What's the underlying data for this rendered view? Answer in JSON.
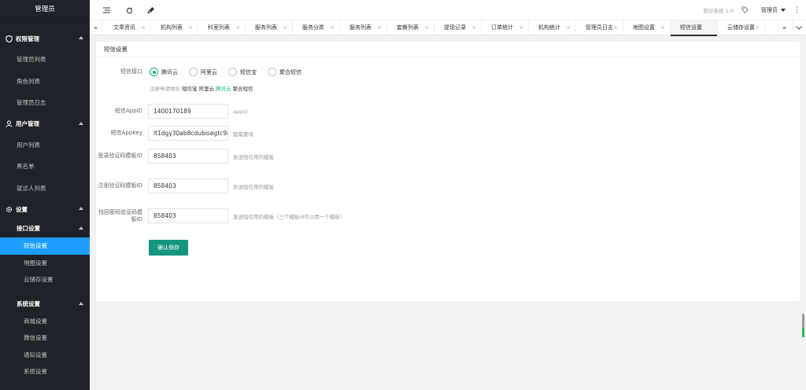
{
  "sidebar": {
    "logo": "管理员",
    "groups": {
      "perm": {
        "label": "权限管理",
        "items": [
          "管理员列表",
          "角色列表",
          "管理员日志"
        ]
      },
      "user": {
        "label": "用户管理",
        "items": [
          "用户列表",
          "黑名单",
          "就诊人列表"
        ]
      },
      "settings": {
        "label": "设置"
      }
    },
    "interface": {
      "label": "接口设置",
      "items": [
        "短信设置",
        "地图设置",
        "云储存设置"
      ]
    },
    "system": {
      "label": "系统设置",
      "items": [
        "商城设置",
        "微信设置",
        "通知设置",
        "系统设置"
      ]
    }
  },
  "header": {
    "system_name": "陪诊系统 1.0",
    "user": "管理员",
    "more": "⋮"
  },
  "tabs": [
    "文章资讯",
    "机构列表",
    "科室列表",
    "服务列表",
    "服务分类",
    "服务列表",
    "套餐列表",
    "提现记录",
    "订单统计",
    "机构统计",
    "管理员日志",
    "地图设置",
    "短信设置",
    "云储存设置"
  ],
  "tab_active_index": 12,
  "form": {
    "title": "短信设置",
    "provider": {
      "label": "短信接口",
      "options": [
        "腾讯云",
        "阿里云",
        "短信宝",
        "聚合短信"
      ],
      "selected": "腾讯云",
      "register_prefix": "注册申请地址",
      "register_links": [
        "短信宝",
        "阿里云",
        "腾讯云",
        "聚合短信"
      ]
    },
    "appid": {
      "label": "短信AppID",
      "value": "1400170189",
      "hint": "appid"
    },
    "appkey": {
      "label": "短信AppKey",
      "value": "lt1dgy30ab8cdubisegtc9nwq",
      "hint": "都需要填"
    },
    "login_tpl": {
      "label": "登录验证码模板ID",
      "value": "858403",
      "hint": "发送短信用的模板"
    },
    "register_tpl": {
      "label": "注册验证码模板ID",
      "value": "858403",
      "hint": "发送短信用的模板"
    },
    "reset_tpl": {
      "label": "找回密码验证码模板ID",
      "value": "858403",
      "hint": "发送短信用的模板（三个模板id可以用一个模板）"
    },
    "save_label": "确认保存"
  },
  "colors": {
    "sidebar_bg": "#20222a",
    "active_blue": "#1e9fff",
    "accent_green": "#16b777",
    "button_teal": "#16967f"
  }
}
